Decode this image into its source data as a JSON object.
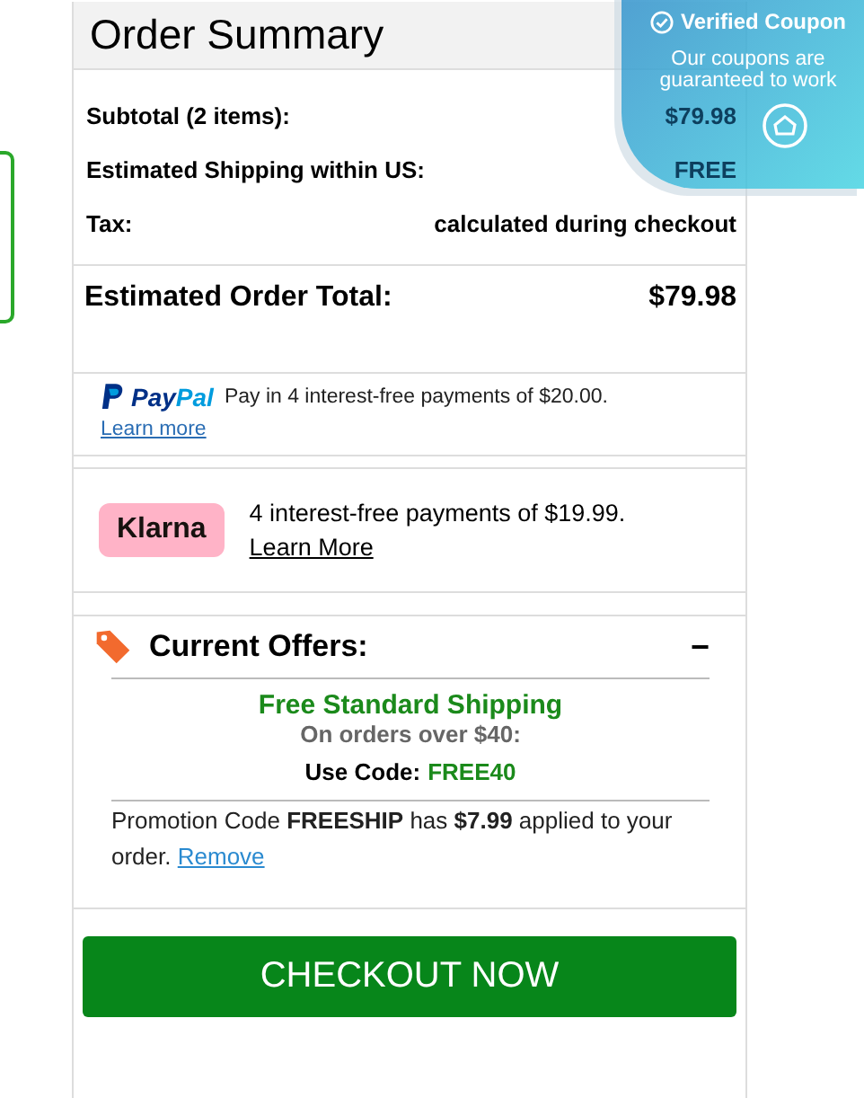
{
  "title": "Order Summary",
  "rows": [
    {
      "label": "Subtotal (2 items):",
      "value": "$79.98"
    },
    {
      "label": "Estimated Shipping within US:",
      "value": "FREE"
    },
    {
      "label": "Tax:",
      "value": "calculated during checkout"
    }
  ],
  "total": {
    "label": "Estimated Order Total:",
    "value": "$79.98"
  },
  "paypal": {
    "logo": "PayPal",
    "text": "Pay in 4 interest-free payments of $20.00.",
    "link": "Learn more"
  },
  "klarna": {
    "logo": "Klarna",
    "text": "4 interest-free payments of $19.99.",
    "link": "Learn More"
  },
  "offers": {
    "title": "Current Offers:",
    "toggle": "−",
    "expanded": true,
    "headline": "Free Standard Shipping",
    "condition": "On orders over $40:",
    "code_label": "Use Code:",
    "code": "FREE40",
    "promo": "Promotion Code **FREESHIP** has **$7.99** applied to your order.",
    "remove": "Remove"
  },
  "checkout": "CHECKOUT NOW",
  "coupon_badge": {
    "title": "Verified Coupon",
    "text": "Our coupons are guaranteed to work"
  }
}
